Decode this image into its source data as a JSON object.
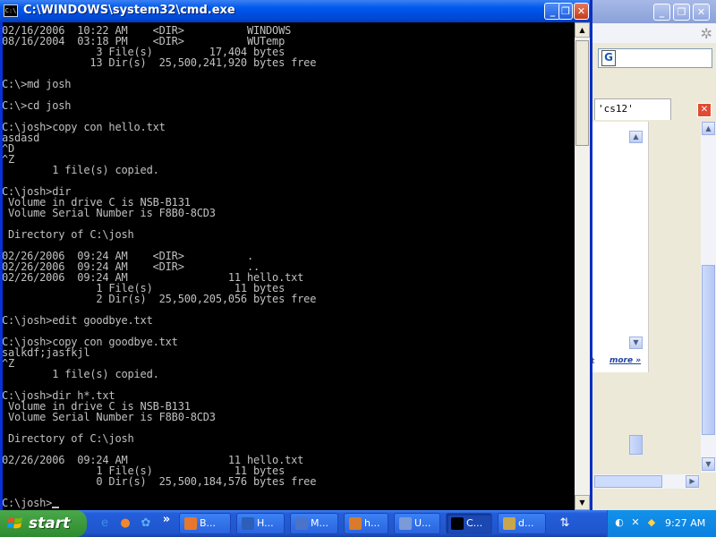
{
  "cmd_window": {
    "title": "C:\\WINDOWS\\system32\\cmd.exe",
    "icon_label": "C:\\",
    "console_lines": [
      "02/16/2006  10:22 AM    <DIR>          WINDOWS",
      "08/16/2004  03:18 PM    <DIR>          WUTemp",
      "               3 File(s)         17,404 bytes",
      "              13 Dir(s)  25,500,241,920 bytes free",
      "",
      "C:\\>md josh",
      "",
      "C:\\>cd josh",
      "",
      "C:\\josh>copy con hello.txt",
      "asdasd",
      "^D",
      "^Z",
      "        1 file(s) copied.",
      "",
      "C:\\josh>dir",
      " Volume in drive C is NSB-B131",
      " Volume Serial Number is F8B0-8CD3",
      "",
      " Directory of C:\\josh",
      "",
      "02/26/2006  09:24 AM    <DIR>          .",
      "02/26/2006  09:24 AM    <DIR>          ..",
      "02/26/2006  09:24 AM                11 hello.txt",
      "               1 File(s)             11 bytes",
      "               2 Dir(s)  25,500,205,056 bytes free",
      "",
      "C:\\josh>edit goodbye.txt",
      "",
      "C:\\josh>copy con goodbye.txt",
      "salkdf;jasfkjl",
      "^Z",
      "        1 file(s) copied.",
      "",
      "C:\\josh>dir h*.txt",
      " Volume in drive C is NSB-B131",
      " Volume Serial Number is F8B0-8CD3",
      "",
      " Directory of C:\\josh",
      "",
      "02/26/2006  09:24 AM                11 hello.txt",
      "               1 File(s)             11 bytes",
      "               0 Dir(s)  25,500,184,576 bytes free",
      ""
    ],
    "prompt": "C:\\josh>"
  },
  "background_window": {
    "tab_label": "'cs12'",
    "more_link": "more »",
    "more_prefix": "t"
  },
  "taskbar": {
    "start_label": "start",
    "buttons": [
      {
        "label": "B...",
        "icon_color": "#e8772e"
      },
      {
        "label": "H...",
        "icon_color": "#2b5fb8"
      },
      {
        "label": "M...",
        "icon_color": "#4b74c9"
      },
      {
        "label": "h...",
        "icon_color": "#d97b2a"
      },
      {
        "label": "U...",
        "icon_color": "#7a9ad8"
      },
      {
        "label": "C...",
        "icon_color": "#000000"
      },
      {
        "label": "d...",
        "icon_color": "#c9a64b"
      }
    ],
    "expand_label": "»",
    "clock": "9:27 AM"
  }
}
